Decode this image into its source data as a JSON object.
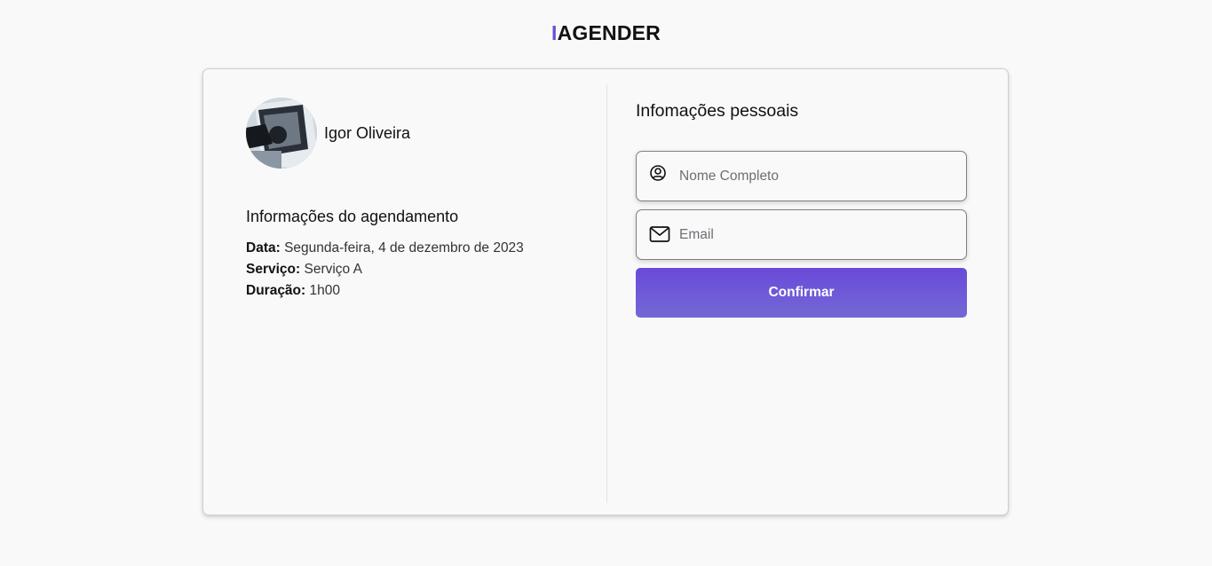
{
  "header": {
    "logo_prefix": "I",
    "logo_rest": "AGENDER"
  },
  "professional": {
    "name": "Igor Oliveira",
    "avatar": "professional-photo"
  },
  "appointment": {
    "title": "Informações do agendamento",
    "date_label": "Data:",
    "date_value": "Segunda-feira, 4 de dezembro de 2023",
    "service_label": "Serviço:",
    "service_value": "Serviço A",
    "duration_label": "Duração:",
    "duration_value": "1h00"
  },
  "personal": {
    "title": "Infomações pessoais",
    "name_field": {
      "placeholder": "Nome Completo",
      "value": "",
      "icon": "user-circle-icon"
    },
    "email_field": {
      "placeholder": "Email",
      "value": "",
      "icon": "mail-icon"
    },
    "confirm_label": "Confirmar"
  },
  "colors": {
    "accent": "#6a4fd8",
    "button_gradient_start": "#6a4ad8",
    "button_gradient_end": "#7368d6",
    "background": "#f9f9f9"
  }
}
